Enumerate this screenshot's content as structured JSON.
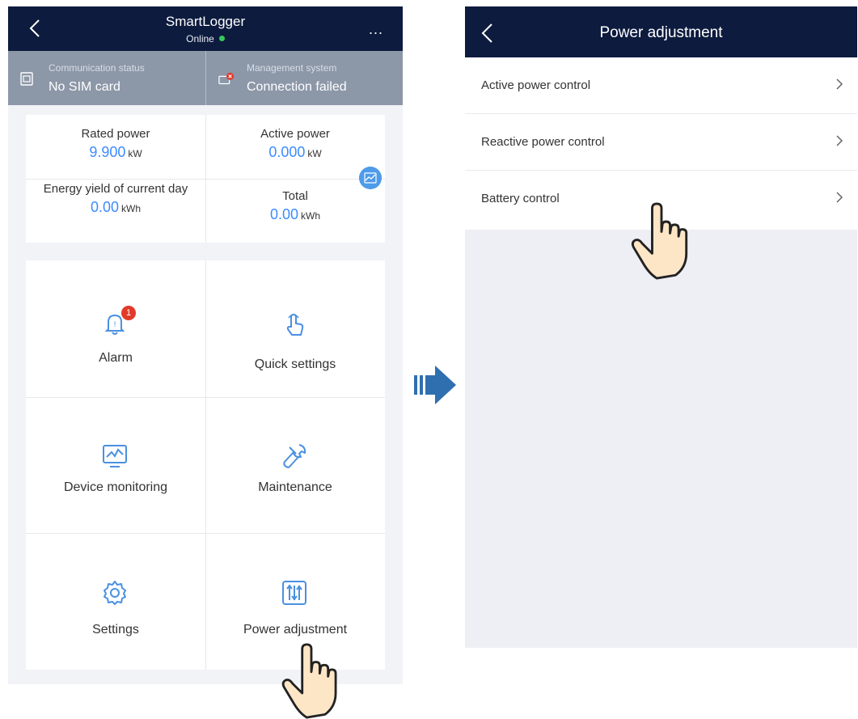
{
  "left": {
    "header": {
      "title": "SmartLogger",
      "status": "Online",
      "more": "..."
    },
    "status_bar": {
      "communication": {
        "label": "Communication status",
        "value": "No SIM card"
      },
      "management": {
        "label": "Management system",
        "value": "Connection failed"
      }
    },
    "power": {
      "rated": {
        "label": "Rated power",
        "value": "9.900",
        "unit": "kW"
      },
      "active": {
        "label": "Active power",
        "value": "0.000",
        "unit": "kW"
      },
      "energy_today": {
        "label": "Energy yield of current day",
        "value": "0.00",
        "unit": "kWh"
      },
      "total": {
        "label": "Total",
        "value": "0.00",
        "unit": "kWh"
      }
    },
    "menu": {
      "alarm": {
        "label": "Alarm",
        "badge": "1",
        "icon": "bell-icon"
      },
      "quick_settings": {
        "label": "Quick settings",
        "icon": "tap-hand-icon"
      },
      "device_monitoring": {
        "label": "Device monitoring",
        "icon": "monitor-chart-icon"
      },
      "maintenance": {
        "label": "Maintenance",
        "icon": "wrench-icon"
      },
      "settings": {
        "label": "Settings",
        "icon": "gear-icon"
      },
      "power_adjustment": {
        "label": "Power adjustment",
        "icon": "sliders-icon"
      }
    }
  },
  "right": {
    "header": {
      "title": "Power adjustment"
    },
    "items": [
      {
        "label": "Active power control"
      },
      {
        "label": "Reactive power control"
      },
      {
        "label": "Battery control"
      }
    ]
  },
  "colors": {
    "header_bg": "#0d1b3e",
    "status_bg": "#8c97a8",
    "accent_blue": "#3d8bff",
    "online_green": "#35c95a",
    "badge_red": "#e23a2a",
    "arrow_blue": "#2f6fb0"
  }
}
